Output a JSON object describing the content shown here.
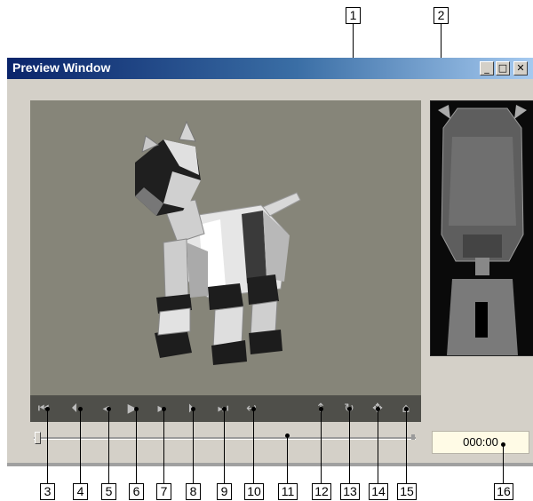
{
  "window": {
    "title": "Preview Window",
    "buttons": {
      "minimize": "_",
      "maximize": "□",
      "close": "✕"
    }
  },
  "controls": [
    {
      "name": "first-frame-button",
      "glyph": "⏮"
    },
    {
      "name": "previous-keyframe-button",
      "glyph": "⏴"
    },
    {
      "name": "previous-frame-button",
      "glyph": "◂"
    },
    {
      "name": "play-button",
      "glyph": "▶"
    },
    {
      "name": "next-frame-button",
      "glyph": "▸"
    },
    {
      "name": "next-keyframe-button",
      "glyph": "⏵"
    },
    {
      "name": "last-frame-button",
      "glyph": "⏭"
    },
    {
      "name": "loop-button",
      "glyph": "↩"
    },
    {
      "name": "move-camera-button",
      "glyph": "⇡"
    },
    {
      "name": "rotate-view-button",
      "glyph": "↻"
    },
    {
      "name": "pan-view-button",
      "glyph": "✥"
    },
    {
      "name": "reset-view-button",
      "glyph": "⌂"
    }
  ],
  "time_display": "000:00",
  "callouts": [
    "1",
    "2",
    "3",
    "4",
    "5",
    "6",
    "7",
    "8",
    "9",
    "10",
    "11",
    "12",
    "13",
    "14",
    "15",
    "16"
  ],
  "colors": {
    "viewport_bg": "#868579",
    "controlbar_bg": "#4f4f4a",
    "titlebar_start": "#0a246a",
    "titlebar_end": "#a6caf0"
  }
}
